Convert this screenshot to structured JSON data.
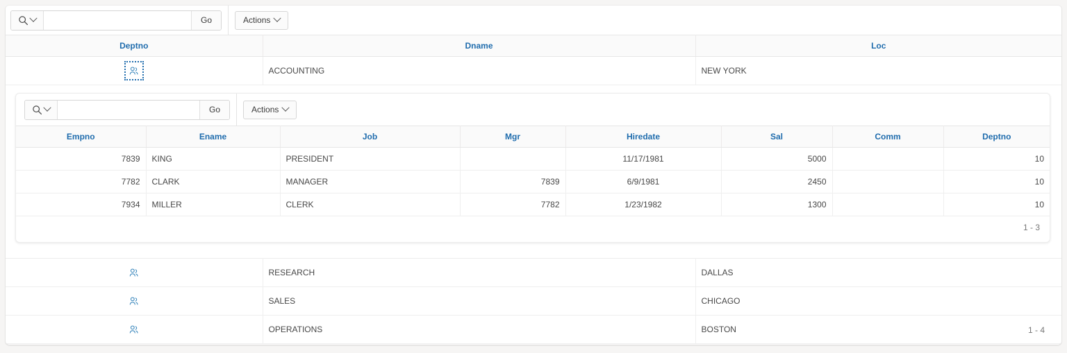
{
  "outer_report": {
    "toolbar": {
      "search_icon": "magnifier-icon",
      "search_value": "",
      "search_placeholder": "",
      "go_label": "Go",
      "actions_label": "Actions"
    },
    "columns": [
      "Deptno",
      "Dname",
      "Loc"
    ],
    "rows": [
      {
        "icon": "users-group-icon",
        "dname": "ACCOUNTING",
        "loc": "NEW YORK",
        "focused": true
      },
      {
        "icon": "users-group-icon",
        "dname": "RESEARCH",
        "loc": "DALLAS",
        "focused": false
      },
      {
        "icon": "users-group-icon",
        "dname": "SALES",
        "loc": "CHICAGO",
        "focused": false
      },
      {
        "icon": "users-group-icon",
        "dname": "OPERATIONS",
        "loc": "BOSTON",
        "focused": false
      }
    ],
    "pagination": "1 - 4"
  },
  "inner_report": {
    "toolbar": {
      "search_icon": "magnifier-icon",
      "search_value": "",
      "search_placeholder": "",
      "go_label": "Go",
      "actions_label": "Actions"
    },
    "columns": [
      "Empno",
      "Ename",
      "Job",
      "Mgr",
      "Hiredate",
      "Sal",
      "Comm",
      "Deptno"
    ],
    "rows": [
      {
        "empno": "7839",
        "ename": "KING",
        "job": "PRESIDENT",
        "mgr": "",
        "hiredate": "11/17/1981",
        "sal": "5000",
        "comm": "",
        "deptno": "10"
      },
      {
        "empno": "7782",
        "ename": "CLARK",
        "job": "MANAGER",
        "mgr": "7839",
        "hiredate": "6/9/1981",
        "sal": "2450",
        "comm": "",
        "deptno": "10"
      },
      {
        "empno": "7934",
        "ename": "MILLER",
        "job": "CLERK",
        "mgr": "7782",
        "hiredate": "1/23/1982",
        "sal": "1300",
        "comm": "",
        "deptno": "10"
      }
    ],
    "pagination": "1 - 3"
  },
  "colors": {
    "header_text": "#1f6cad",
    "page_bg": "#f6f5f4",
    "card_bg": "#ffffff",
    "grid_line": "#eeeeee",
    "focus_outline": "#1f6cad"
  }
}
